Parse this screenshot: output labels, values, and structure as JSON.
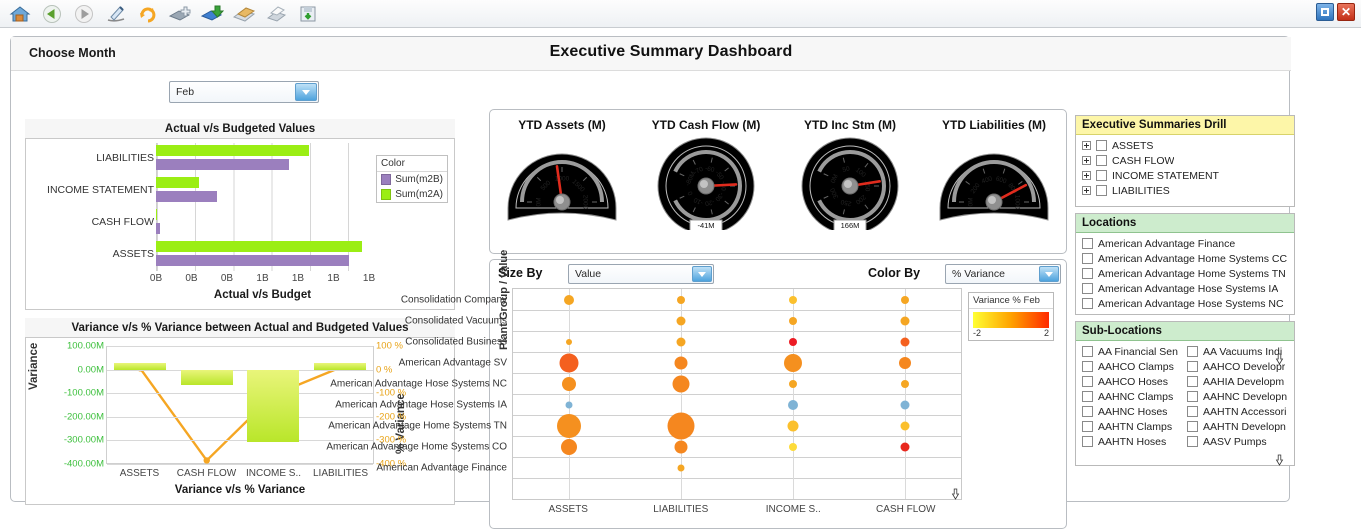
{
  "window": {
    "restore_label": "restore",
    "close_label": "✕"
  },
  "toolbar": {
    "items": [
      {
        "name": "home-icon",
        "label": "Home"
      },
      {
        "name": "back-icon",
        "label": "Back"
      },
      {
        "name": "forward-icon",
        "label": "Forward"
      },
      {
        "name": "edit-icon",
        "label": "Edit"
      },
      {
        "name": "refresh-icon",
        "label": "Refresh"
      },
      {
        "name": "new-book-icon",
        "label": "New"
      },
      {
        "name": "open-book-icon",
        "label": "Open"
      },
      {
        "name": "folder-icon",
        "label": "Folder"
      },
      {
        "name": "print-icon",
        "label": "Print"
      },
      {
        "name": "save-icon",
        "label": "Save"
      }
    ]
  },
  "header": {
    "choose_month_label": "Choose Month",
    "month_value": "Feb",
    "dashboard_title": "Executive Summary Dashboard"
  },
  "size_by": {
    "label": "Size By",
    "value": "Value"
  },
  "color_by": {
    "label": "Color By",
    "value": "% Variance"
  },
  "chart_data": [
    {
      "type": "bar",
      "title": "Actual v/s Budgeted Values",
      "xlabel": "Actual v/s Budget",
      "ylabel": "",
      "orientation": "horizontal",
      "categories": [
        "LIABILITIES",
        "INCOME STATEMENT",
        "CASH FLOW",
        "ASSETS"
      ],
      "tick_labels": [
        "0B",
        "0B",
        "0B",
        "1B",
        "1B",
        "1B",
        "1B"
      ],
      "legend_title": "Color",
      "series": [
        {
          "name": "Sum(m2A)",
          "color": "#9bee14",
          "values": [
            0.72,
            0.2,
            0.006,
            0.965
          ]
        },
        {
          "name": "Sum(m2B)",
          "color": "#9b7fbe",
          "values": [
            0.625,
            0.285,
            0.02,
            0.905
          ]
        }
      ]
    },
    {
      "type": "line",
      "title": "Variance v/s % Variance between Actual and Budgeted Values",
      "xlabel": "Variance v/s % Variance",
      "ylabel": "Variance",
      "y2label": "% Variance",
      "categories": [
        "ASSETS",
        "CASH FLOW",
        "INCOME S..",
        "LIABILITIES"
      ],
      "yticks": [
        "100.00M",
        "0.00M",
        "-100.00M",
        "-200.00M",
        "-300.00M",
        "-400.00M"
      ],
      "y2ticks": [
        "100 %",
        "0 %",
        "-100 %",
        "-200 %",
        "-300 %",
        "-400 %"
      ],
      "ylim": [
        -400,
        100
      ],
      "bar_values": [
        30,
        -65,
        -305,
        28
      ],
      "line_values": [
        5,
        -385,
        -108,
        8
      ],
      "bar_color": "#c6e82e",
      "line_color": "#f5a623"
    },
    {
      "type": "scatter",
      "title": "Plant Group / value",
      "xlabel": "",
      "legend_title": "Variance % Feb",
      "legend_min": "-2",
      "legend_max": "2",
      "columns": [
        "ASSETS",
        "LIABILITIES",
        "INCOME S..",
        "CASH FLOW"
      ],
      "rows": [
        "Consolidation Company",
        "Consolidated Vacuums",
        "Consolidated Business",
        "American Advantage SV",
        "American Advantage Hose Systems NC",
        "American Advantage Hose Systems  IA",
        "American Advantage Home Systems TN",
        "American Advantage Home Systems CO",
        "American Advantage Finance"
      ],
      "points": [
        {
          "row": 0,
          "col": 0,
          "size": 10,
          "color": "#f5a623"
        },
        {
          "row": 0,
          "col": 1,
          "size": 8,
          "color": "#f5a623"
        },
        {
          "row": 0,
          "col": 2,
          "size": 8,
          "color": "#fbc02d"
        },
        {
          "row": 0,
          "col": 3,
          "size": 8,
          "color": "#f5a623"
        },
        {
          "row": 1,
          "col": 1,
          "size": 9,
          "color": "#f5a623"
        },
        {
          "row": 1,
          "col": 2,
          "size": 8,
          "color": "#f5a623"
        },
        {
          "row": 1,
          "col": 3,
          "size": 9,
          "color": "#f5a623"
        },
        {
          "row": 2,
          "col": 0,
          "size": 6,
          "color": "#f5a623"
        },
        {
          "row": 2,
          "col": 1,
          "size": 9,
          "color": "#f5a623"
        },
        {
          "row": 2,
          "col": 2,
          "size": 8,
          "color": "#ec1c24"
        },
        {
          "row": 2,
          "col": 3,
          "size": 9,
          "color": "#f4601f"
        },
        {
          "row": 3,
          "col": 0,
          "size": 19,
          "color": "#f4601f"
        },
        {
          "row": 3,
          "col": 1,
          "size": 13,
          "color": "#f5871f"
        },
        {
          "row": 3,
          "col": 2,
          "size": 18,
          "color": "#f5901f"
        },
        {
          "row": 3,
          "col": 3,
          "size": 12,
          "color": "#f5871f"
        },
        {
          "row": 4,
          "col": 0,
          "size": 14,
          "color": "#f5901f"
        },
        {
          "row": 4,
          "col": 1,
          "size": 17,
          "color": "#f5871f"
        },
        {
          "row": 4,
          "col": 2,
          "size": 8,
          "color": "#f5a623"
        },
        {
          "row": 4,
          "col": 3,
          "size": 8,
          "color": "#f5a623"
        },
        {
          "row": 5,
          "col": 0,
          "size": 7,
          "color": "#7fb3d5"
        },
        {
          "row": 5,
          "col": 2,
          "size": 10,
          "color": "#7fb3d5"
        },
        {
          "row": 5,
          "col": 3,
          "size": 9,
          "color": "#7fb3d5"
        },
        {
          "row": 6,
          "col": 0,
          "size": 24,
          "color": "#f5901f"
        },
        {
          "row": 6,
          "col": 1,
          "size": 27,
          "color": "#f5871f"
        },
        {
          "row": 6,
          "col": 2,
          "size": 11,
          "color": "#fbc02d"
        },
        {
          "row": 6,
          "col": 3,
          "size": 9,
          "color": "#fbc02d"
        },
        {
          "row": 7,
          "col": 0,
          "size": 16,
          "color": "#f5871f"
        },
        {
          "row": 7,
          "col": 1,
          "size": 13,
          "color": "#f5871f"
        },
        {
          "row": 7,
          "col": 2,
          "size": 8,
          "color": "#fddb3a"
        },
        {
          "row": 7,
          "col": 3,
          "size": 9,
          "color": "#e8281e"
        },
        {
          "row": 8,
          "col": 1,
          "size": 7,
          "color": "#f5a623"
        }
      ]
    }
  ],
  "gauges": [
    {
      "title": "YTD Assets (M)",
      "shape": "half",
      "value": "",
      "ticks": [
        "0M",
        "500",
        "1000",
        "1500",
        "2000"
      ],
      "needle_deg": -8
    },
    {
      "title": "YTD Cash Flow (M)",
      "shape": "round",
      "value": "-41M",
      "ticks": [
        "-80M",
        "-70",
        "-60",
        "-50",
        "-40",
        "-30",
        "-20",
        "-10",
        "0"
      ],
      "needle_deg": -3
    },
    {
      "title": "YTD Inc Stm (M)",
      "shape": "round",
      "value": "166M",
      "ticks": [
        "0M",
        "50",
        "100",
        "150",
        "200",
        "250",
        "300"
      ],
      "needle_deg": -9
    },
    {
      "title": "YTD Liabilities (M)",
      "shape": "half",
      "value": "",
      "ticks": [
        "0M",
        "200",
        "400",
        "600",
        "800",
        "1000"
      ],
      "needle_deg": 62
    }
  ],
  "sidebar": {
    "drill": {
      "title": "Executive Summaries Drill",
      "items": [
        {
          "label": "ASSETS"
        },
        {
          "label": "CASH FLOW"
        },
        {
          "label": "INCOME STATEMENT"
        },
        {
          "label": "LIABILITIES"
        }
      ]
    },
    "locations": {
      "title": "Locations",
      "items": [
        {
          "label": "American Advantage Finance"
        },
        {
          "label": "American Advantage Home Systems CC"
        },
        {
          "label": "American Advantage Home Systems TN"
        },
        {
          "label": "American Advantage Hose Systems  IA"
        },
        {
          "label": "American Advantage Hose Systems NC"
        }
      ]
    },
    "sublocations": {
      "title": "Sub-Locations",
      "left": [
        {
          "label": "AA Financial Sen"
        },
        {
          "label": "AAHCO Clamps"
        },
        {
          "label": "AAHCO Hoses"
        },
        {
          "label": "AAHNC Clamps"
        },
        {
          "label": "AAHNC Hoses"
        },
        {
          "label": "AAHTN Clamps"
        },
        {
          "label": "AAHTN Hoses"
        }
      ],
      "right": [
        {
          "label": "AA Vacuums Indi"
        },
        {
          "label": "AAHCO Developr"
        },
        {
          "label": "AAHIA Developm"
        },
        {
          "label": "AAHNC Developn"
        },
        {
          "label": "AAHTN Accessori"
        },
        {
          "label": "AAHTN Developn"
        },
        {
          "label": "AASV Pumps"
        }
      ]
    }
  }
}
